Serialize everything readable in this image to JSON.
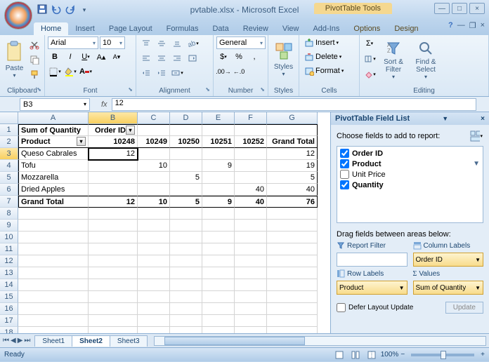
{
  "title": {
    "filename": "pvtable.xlsx",
    "app": "Microsoft Excel",
    "context": "PivotTable Tools"
  },
  "tabs": {
    "home": "Home",
    "insert": "Insert",
    "pagelayout": "Page Layout",
    "formulas": "Formulas",
    "data": "Data",
    "review": "Review",
    "view": "View",
    "addins": "Add-Ins",
    "options": "Options",
    "design": "Design"
  },
  "ribbon": {
    "clipboard": {
      "label": "Clipboard",
      "paste": "Paste"
    },
    "font": {
      "label": "Font",
      "name": "Arial",
      "size": "10"
    },
    "alignment": {
      "label": "Alignment"
    },
    "number": {
      "label": "Number",
      "format": "General"
    },
    "styles": {
      "label": "Styles",
      "btn": "Styles"
    },
    "cells": {
      "label": "Cells",
      "insert": "Insert",
      "delete": "Delete",
      "format": "Format"
    },
    "editing": {
      "label": "Editing",
      "sort": "Sort & Filter",
      "find": "Find & Select"
    }
  },
  "namebox": "B3",
  "formula": "12",
  "cols": [
    "",
    "A",
    "B",
    "C",
    "D",
    "E",
    "F",
    "G"
  ],
  "rows": [
    {
      "n": "1",
      "c": [
        "Sum of Quantity",
        "Order ID",
        "",
        "",
        "",
        "",
        ""
      ],
      "bold": true,
      "drop": [
        1
      ]
    },
    {
      "n": "2",
      "c": [
        "Product",
        "10248",
        "10249",
        "10250",
        "10251",
        "10252",
        "Grand Total"
      ],
      "bold": true,
      "drop": [
        0
      ]
    },
    {
      "n": "3",
      "c": [
        "Queso Cabrales",
        "12",
        "",
        "",
        "",
        "",
        "12"
      ]
    },
    {
      "n": "4",
      "c": [
        "Tofu",
        "",
        "10",
        "",
        "9",
        "",
        "19"
      ]
    },
    {
      "n": "5",
      "c": [
        "Mozzarella",
        "",
        "",
        "5",
        "",
        "",
        "5"
      ]
    },
    {
      "n": "6",
      "c": [
        "Dried Apples",
        "",
        "",
        "",
        "",
        "40",
        "40"
      ]
    },
    {
      "n": "7",
      "c": [
        "Grand Total",
        "12",
        "10",
        "5",
        "9",
        "40",
        "76"
      ],
      "bold": true
    }
  ],
  "blankRows": [
    "8",
    "9",
    "10",
    "11",
    "12",
    "13",
    "14",
    "15",
    "16",
    "17",
    "18"
  ],
  "fieldlist": {
    "title": "PivotTable Field List",
    "choose": "Choose fields to add to report:",
    "fields": [
      {
        "name": "Order ID",
        "checked": true
      },
      {
        "name": "Product",
        "checked": true,
        "filter": true
      },
      {
        "name": "Unit Price",
        "checked": false
      },
      {
        "name": "Quantity",
        "checked": true
      }
    ],
    "drag": "Drag fields between areas below:",
    "areas": {
      "reportFilter": "Report Filter",
      "columnLabels": "Column Labels",
      "rowLabels": "Row Labels",
      "values": "Values",
      "colVal": "Order ID",
      "rowVal": "Product",
      "valVal": "Sum of Quantity"
    },
    "defer": "Defer Layout Update",
    "update": "Update"
  },
  "sheets": {
    "s1": "Sheet1",
    "s2": "Sheet2",
    "s3": "Sheet3"
  },
  "status": {
    "ready": "Ready",
    "zoom": "100%"
  }
}
